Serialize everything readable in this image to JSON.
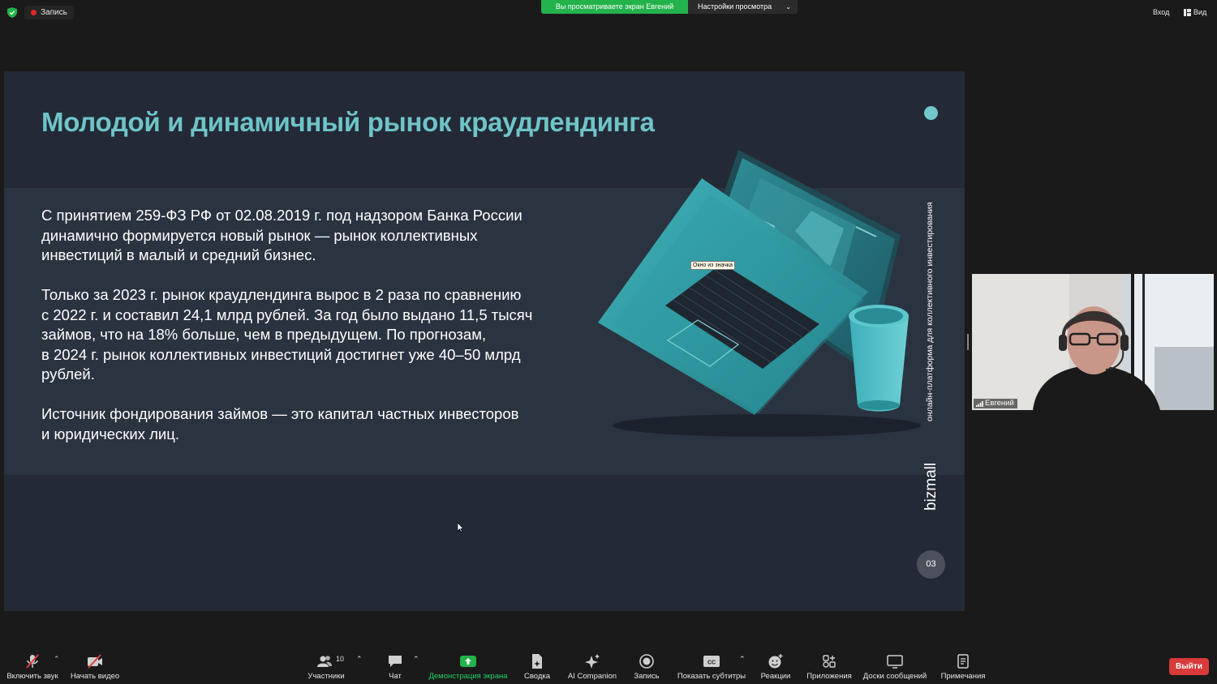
{
  "topbar": {
    "record_label": "Запись",
    "viewing_banner": "Вы просматриваете экран Евгений",
    "view_settings": "Настройки просмотра",
    "enter_label": "Вход",
    "view_label": "Вид"
  },
  "slide": {
    "title": "Молодой и динамичный рынок краудлендинга",
    "paragraphs": [
      "С принятием 259-ФЗ РФ от 02.08.2019 г. под надзором Банка России\nдинамично формируется новый рынок — рынок коллективных\nинвестиций в малый и средний бизнес.",
      "Только за 2023 г. рынок краудлендинга вырос в 2 раза по сравнению\nс 2022 г. и составил 24,1 млрд рублей. За год было выдано 11,5 тысяч\nзаймов, что на 18% больше, чем в предыдущем. По прогнозам,\nв 2024 г. рынок коллективных инвестиций достигнет уже 40–50 млрд\nрублей.",
      "Источник фондирования займов — это капитал частных инвесторов\nи юридических лиц."
    ],
    "vertical_caption": "онлайн-платформа для коллективного инвестирования",
    "brand": "bizmall",
    "page_number": "03",
    "tooltip": "Окно из значка"
  },
  "video": {
    "participant_name": "Евгений"
  },
  "toolbar": {
    "unmute": "Включить звук",
    "start_video": "Начать видео",
    "participants": "Участники",
    "participants_count": "10",
    "chat": "Чат",
    "share_screen": "Демонстрация экрана",
    "summary": "Сводка",
    "ai_companion": "AI Companion",
    "record": "Запись",
    "captions": "Показать субтитры",
    "reactions": "Реакции",
    "apps": "Приложения",
    "whiteboards": "Доски сообщений",
    "notes": "Примечания",
    "leave": "Выйти"
  },
  "colors": {
    "accent_teal": "#6fc4c8",
    "share_green": "#23b24b",
    "leave_red": "#d83a3a"
  }
}
